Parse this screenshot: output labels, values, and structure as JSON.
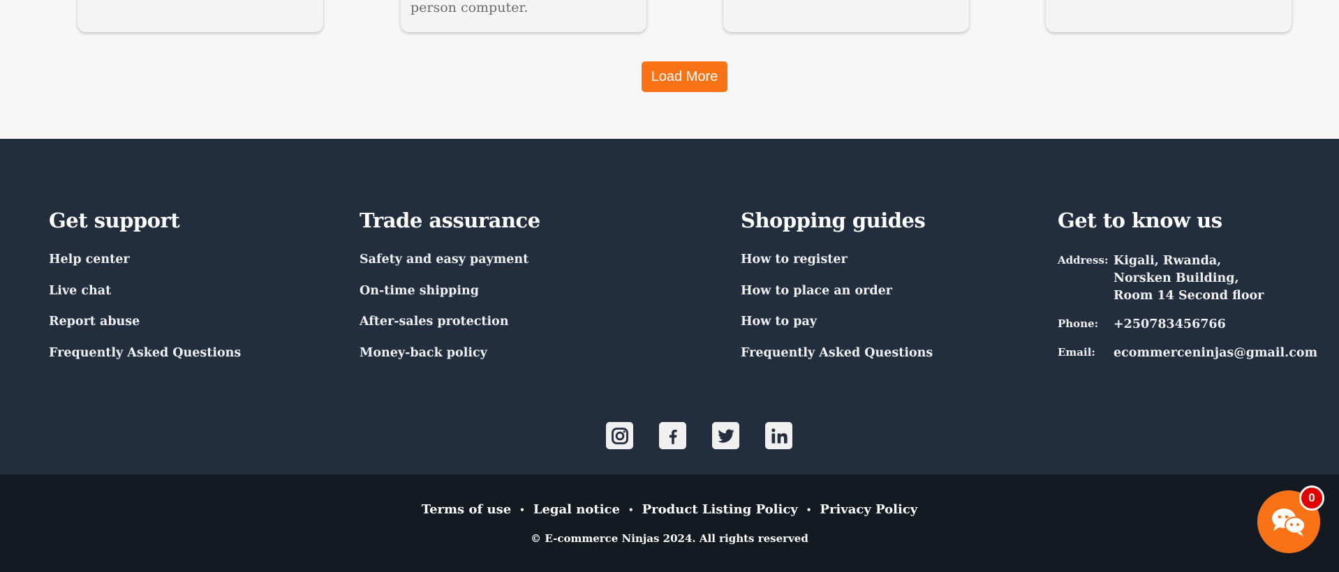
{
  "cards": {
    "items": [
      {
        "text": ""
      },
      {
        "text": "person computer."
      },
      {
        "text": ""
      },
      {
        "text": ""
      }
    ]
  },
  "load_more_label": "Load More",
  "footer": {
    "get_support": {
      "title": "Get support",
      "links": [
        "Help center",
        "Live chat",
        "Report abuse",
        "Frequently Asked Questions"
      ]
    },
    "trade_assurance": {
      "title": "Trade assurance",
      "links": [
        "Safety and easy payment",
        "On-time shipping",
        "After-sales protection",
        "Money-back policy"
      ]
    },
    "shopping_guides": {
      "title": "Shopping guides",
      "links": [
        "How to register",
        "How to place an order",
        "How to pay",
        "Frequently Asked Questions"
      ]
    },
    "about": {
      "title": "Get to know us",
      "address_label": "Address:",
      "address_lines": [
        "Kigali, Rwanda,",
        "Norsken Building,",
        "Room 14 Second floor"
      ],
      "phone_label": "Phone:",
      "phone": "+250783456766",
      "email_label": "Email:",
      "email": "ecommerceninjas@gmail.com"
    },
    "socials": [
      "instagram-icon",
      "facebook-icon",
      "twitter-icon",
      "linkedin-icon"
    ]
  },
  "bottom": {
    "links": [
      "Terms of use",
      "Legal notice",
      "Product Listing Policy",
      "Privacy Policy"
    ],
    "separator": "•",
    "copyright": "© E-commerce Ninjas 2024. All rights reserved"
  },
  "chat": {
    "badge_count": "0"
  },
  "colors": {
    "accent": "#f97316",
    "footer_bg": "#222d3e",
    "footer_bottom_bg": "#141a22",
    "badge": "#e00000"
  }
}
